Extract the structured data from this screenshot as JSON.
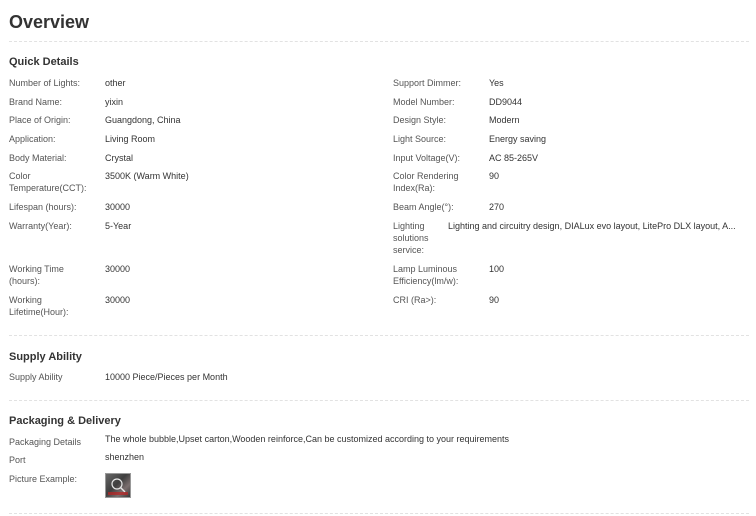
{
  "overview": {
    "title": "Overview"
  },
  "quick_details": {
    "title": "Quick Details",
    "left": [
      {
        "label": "Number of Lights:",
        "value": "other"
      },
      {
        "label": "Brand Name:",
        "value": "yixin"
      },
      {
        "label": "Place of Origin:",
        "value": "Guangdong, China"
      },
      {
        "label": "Application:",
        "value": "Living Room"
      },
      {
        "label": "Body Material:",
        "value": "Crystal"
      },
      {
        "label": "Color Temperature(CCT):",
        "value": "3500K (Warm White)"
      },
      {
        "label": "Lifespan (hours):",
        "value": "30000"
      },
      {
        "label": "Warranty(Year):",
        "value": "5-Year"
      },
      {
        "label": "Working Time (hours):",
        "value": "30000"
      },
      {
        "label": "Working Lifetime(Hour):",
        "value": "30000"
      }
    ],
    "right": [
      {
        "label": "Support Dimmer:",
        "value": "Yes"
      },
      {
        "label": "Model Number:",
        "value": "DD9044"
      },
      {
        "label": "Design Style:",
        "value": "Modern"
      },
      {
        "label": "Light Source:",
        "value": "Energy saving"
      },
      {
        "label": "Input Voltage(V):",
        "value": "AC 85-265V"
      },
      {
        "label": "Color Rendering Index(Ra):",
        "value": "90"
      },
      {
        "label": "Beam Angle(°):",
        "value": "270"
      },
      {
        "label": "Lighting solutions service:",
        "value": "Lighting and circuitry design, DIALux evo layout, LitePro DLX layout, A..."
      },
      {
        "label": "Lamp Luminous Efficiency(lm/w):",
        "value": "100"
      },
      {
        "label": "CRI (Ra>):",
        "value": "90"
      }
    ]
  },
  "supply_ability": {
    "title": "Supply Ability",
    "label": "Supply Ability",
    "value": "10000 Piece/Pieces per Month"
  },
  "packaging": {
    "title": "Packaging & Delivery",
    "details_label": "Packaging Details",
    "details_value": "The whole bubble,Upset carton,Wooden reinforce,Can be customized according to your requirements",
    "port_label": "Port",
    "port_value": "shenzhen",
    "picture_label": "Picture Example:",
    "picture_icon": "product-thumbnail"
  }
}
